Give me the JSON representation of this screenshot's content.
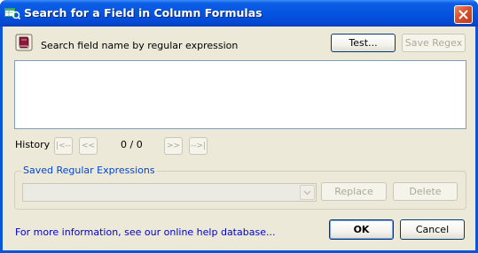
{
  "window": {
    "title": "Search for a Field in Column Formulas",
    "title_icon": "app-formula-icon",
    "close_icon": "close-icon"
  },
  "search": {
    "icon": "help-book-icon",
    "label": "Search field name by regular expression",
    "regex_value": "",
    "test_label": "Test...",
    "save_label": "Save Regex"
  },
  "history": {
    "label": "History :",
    "first_label": "|<--",
    "prev_label": "<<",
    "count": "0 / 0",
    "next_label": ">>",
    "last_label": "-->|"
  },
  "saved": {
    "group_title": "Saved Regular Expressions",
    "selected_value": "",
    "replace_label": "Replace",
    "delete_label": "Delete"
  },
  "footer": {
    "help_link": "For more information, see our online help database...",
    "ok_label": "OK",
    "cancel_label": "Cancel"
  },
  "colors": {
    "titlebar": "#0554e0",
    "client_bg": "#ece9d8",
    "link": "#0000cc",
    "group_title": "#0046d5"
  }
}
